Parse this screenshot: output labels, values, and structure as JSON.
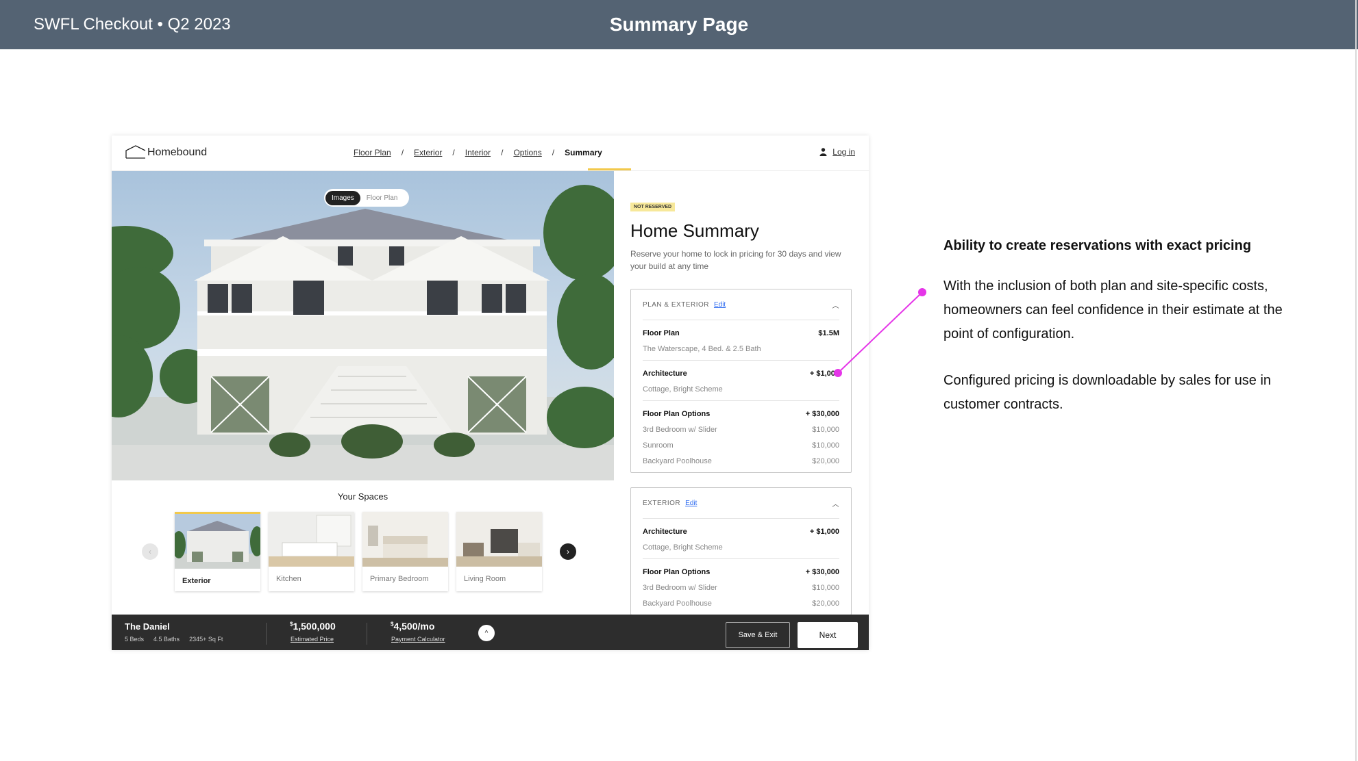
{
  "slide": {
    "header_left": "SWFL Checkout  • Q2 2023",
    "title": "Summary Page"
  },
  "mock": {
    "logo": "Homebound",
    "steps": [
      "Floor Plan",
      "Exterior",
      "Interior",
      "Options",
      "Summary"
    ],
    "step_separator": "/",
    "login": "Log in",
    "toggle": {
      "images": "Images",
      "floor_plan": "Floor Plan"
    },
    "spaces_title": "Your Spaces",
    "spaces": [
      "Exterior",
      "Kitchen",
      "Primary Bedroom",
      "Living Room"
    ],
    "badge": "NOT RESERVED",
    "home_title": "Home Summary",
    "home_sub": "Reserve your home to lock in pricing for 30 days and view your build at any time",
    "card1": {
      "header": "PLAN & EXTERIOR",
      "edit": "Edit",
      "floor_plan": {
        "label": "Floor Plan",
        "value": "$1.5M",
        "sub": "The Waterscape, 4 Bed. & 2.5 Bath"
      },
      "architecture": {
        "label": "Architecture",
        "value": "+ $1,000",
        "sub": "Cottage, Bright Scheme"
      },
      "options": {
        "label": "Floor Plan Options",
        "value": "+ $30,000"
      },
      "option_items": [
        {
          "label": "3rd Bedroom w/ Slider",
          "value": "$10,000"
        },
        {
          "label": "Sunroom",
          "value": "$10,000"
        },
        {
          "label": "Backyard Poolhouse",
          "value": "$20,000"
        }
      ]
    },
    "card2": {
      "header": "EXTERIOR",
      "edit": "Edit",
      "architecture": {
        "label": "Architecture",
        "value": "+ $1,000",
        "sub": "Cottage, Bright Scheme"
      },
      "options": {
        "label": "Floor Plan Options",
        "value": "+ $30,000"
      },
      "option_items": [
        {
          "label": "3rd Bedroom w/ Slider",
          "value": "$10,000"
        },
        {
          "label": "Backyard Poolhouse",
          "value": "$20,000"
        }
      ]
    },
    "bottom": {
      "name": "The Daniel",
      "beds": "5 Beds",
      "baths": "4.5 Baths",
      "sqft": "2345+ Sq Ft",
      "price_sup": "$",
      "price": "1,500,000",
      "price_link": "Estimated Price",
      "monthly_sup": "$",
      "monthly": "4,500/mo",
      "monthly_link": "Payment Calculator",
      "save": "Save & Exit",
      "next": "Next"
    }
  },
  "annotation": {
    "heading": "Ability to create reservations with exact pricing",
    "p1": "With the inclusion of both plan and site-specific costs, homeowners can feel confidence in their estimate at the point of configuration.",
    "p2": "Configured pricing is downloadable by sales for use in customer contracts.",
    "callout_color": "#e535e8"
  },
  "colors": {
    "header_bg": "#546373",
    "accent_yellow": "#f2c94c",
    "edit_blue": "#2f6cf0",
    "bottom_bar": "#2d2d2d"
  }
}
